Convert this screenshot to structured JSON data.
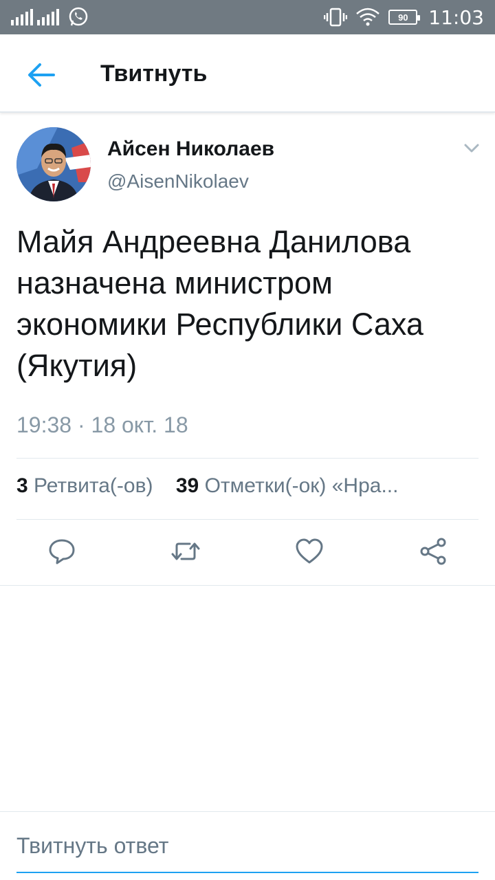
{
  "status_bar": {
    "time": "11:03",
    "battery": "90",
    "icons": [
      "signal-icon",
      "whatsapp-icon",
      "vibrate-icon",
      "wifi-icon",
      "battery-icon"
    ]
  },
  "header": {
    "title": "Твитнуть",
    "back_icon": "arrow-left-icon"
  },
  "tweet": {
    "author_name": "Айсен Николаев",
    "author_handle": "@AisenNikolaev",
    "text": "Майя Андреевна Данилова назначена министром экономики Республики Саха (Якутия)",
    "timestamp": "19:38 · 18 окт. 18",
    "retweets_count": "3",
    "retweets_label": "Ретвита(-ов)",
    "likes_count": "39",
    "likes_label": "Отметки(-ок) «Нра..."
  },
  "reply": {
    "placeholder": "Твитнуть ответ"
  },
  "colors": {
    "accent": "#1da1f2",
    "status_bar": "#707a82",
    "secondary_text": "#657786",
    "icon": "#657786"
  }
}
